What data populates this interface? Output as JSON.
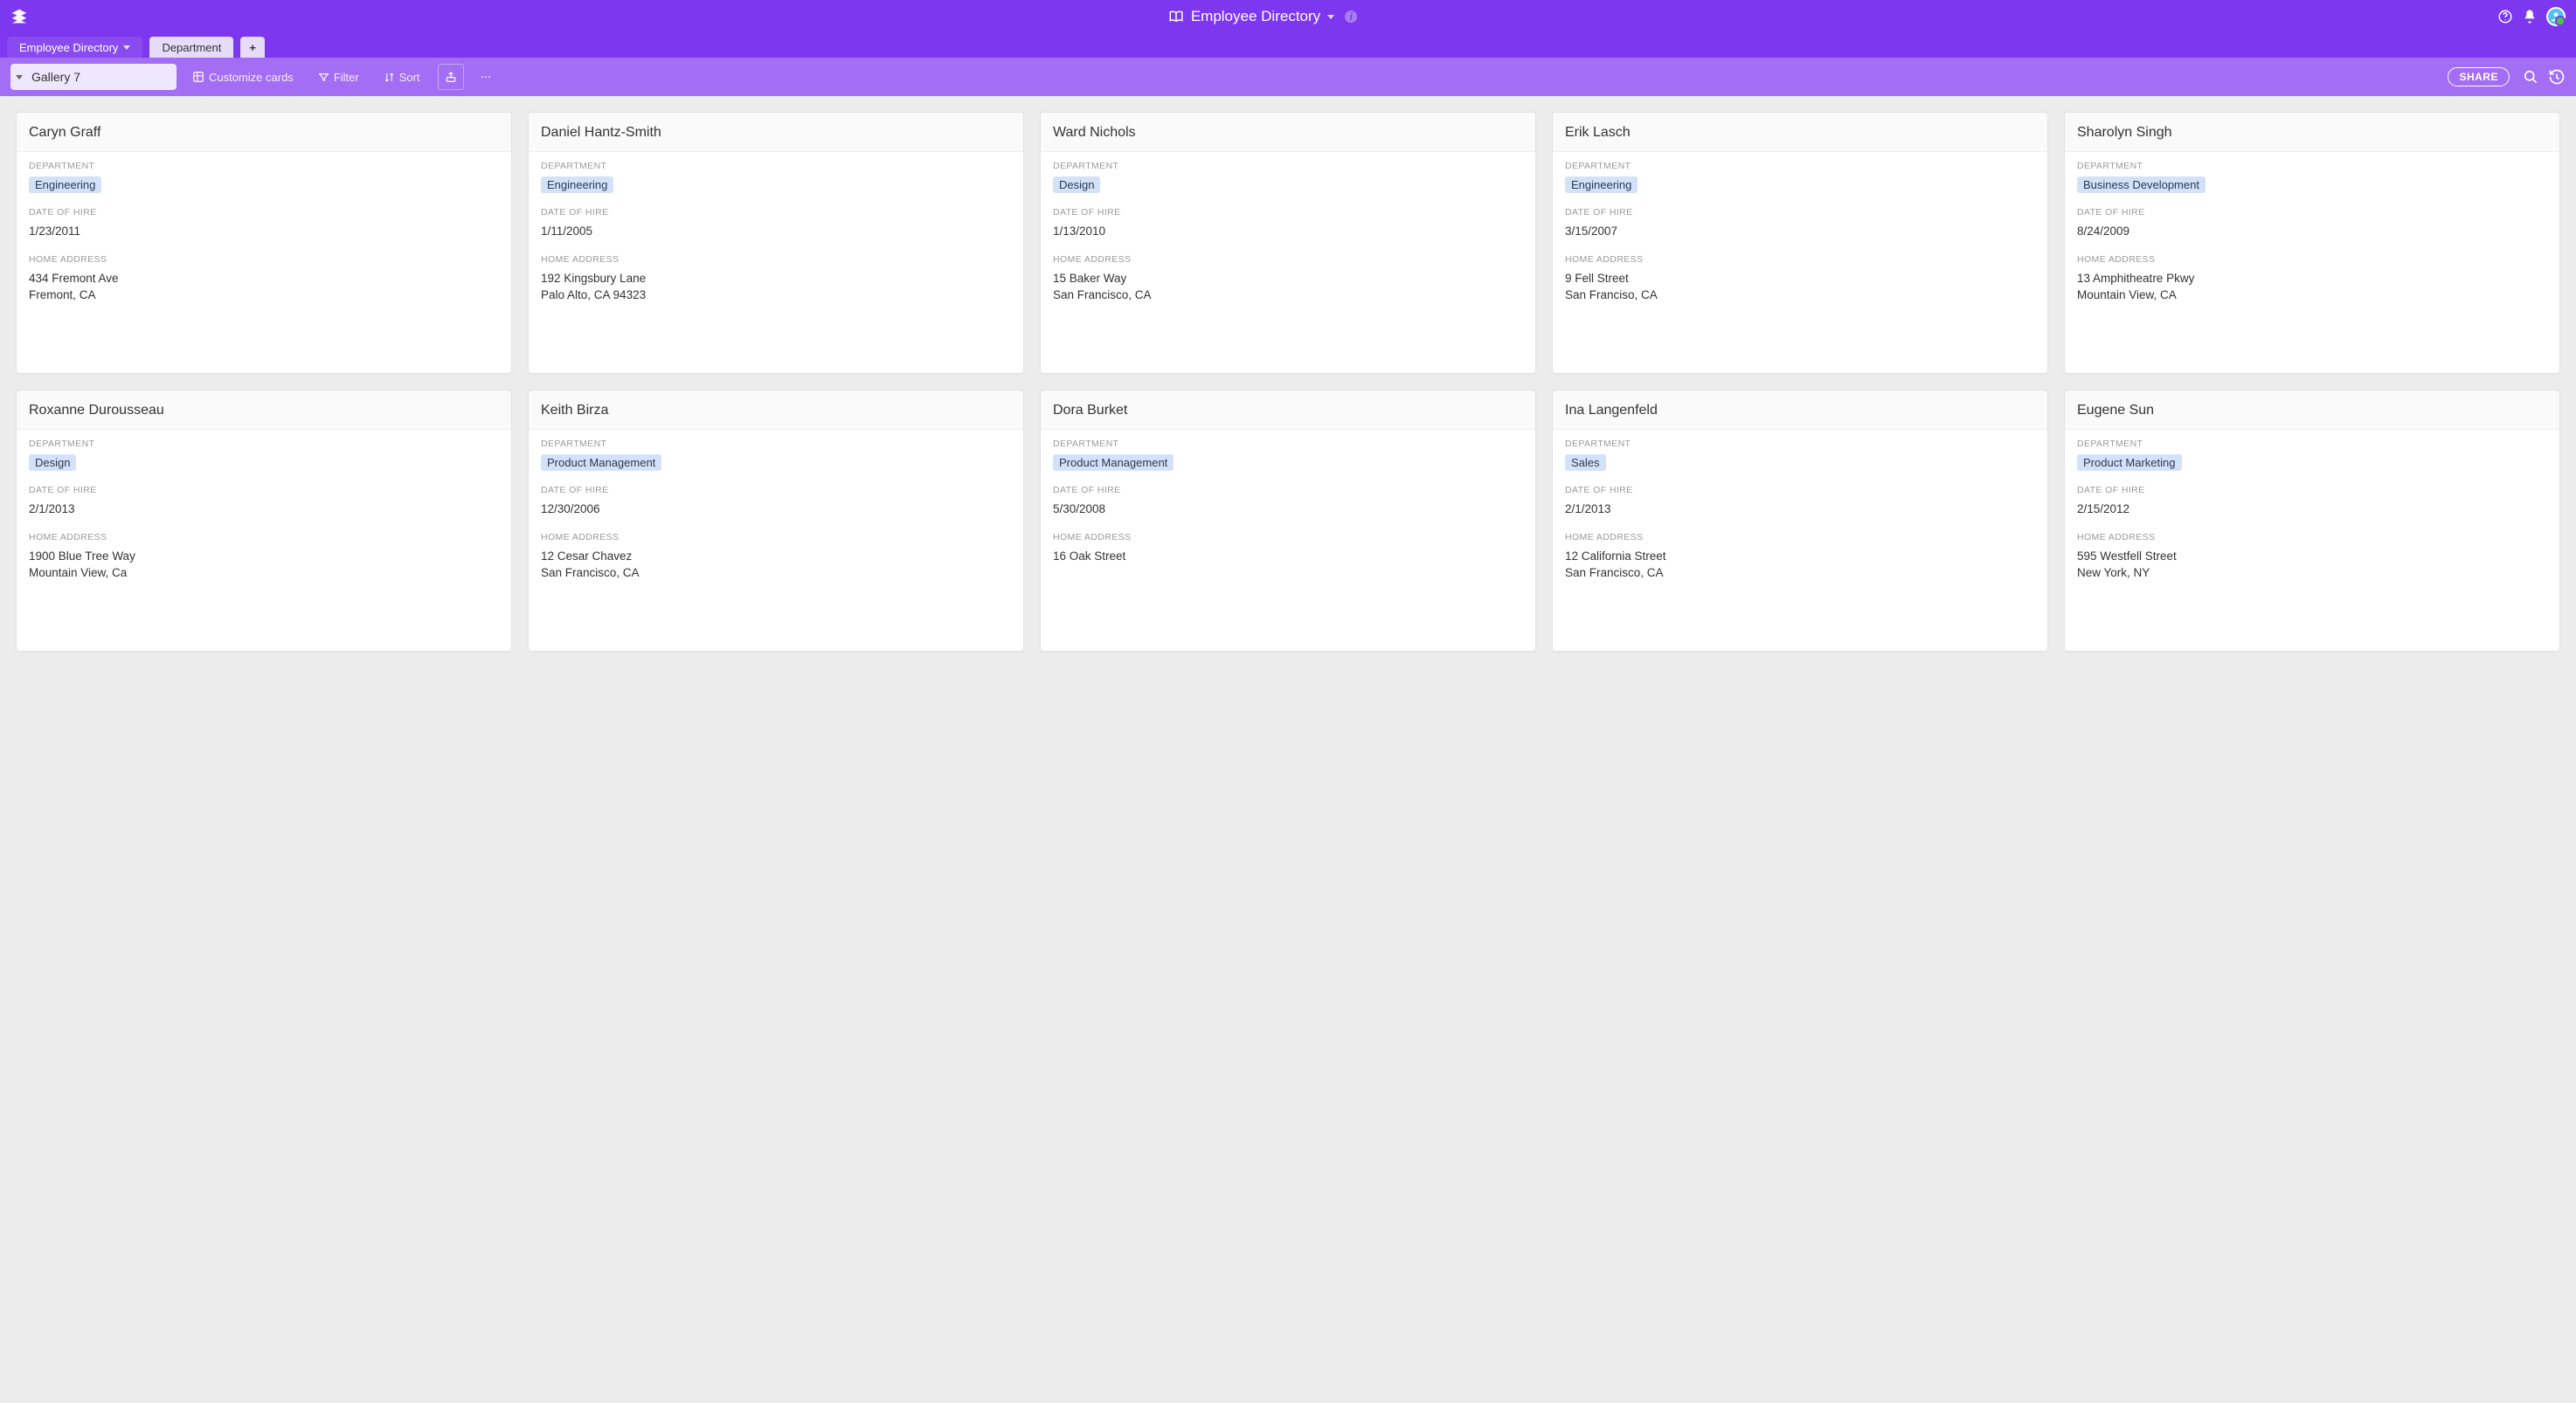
{
  "header": {
    "title": "Employee Directory"
  },
  "tabs": {
    "primary": "Employee Directory",
    "secondary": "Department",
    "add": "+"
  },
  "toolbar": {
    "view_name": "Gallery 7",
    "customize": "Customize cards",
    "filter": "Filter",
    "sort": "Sort",
    "share": "SHARE"
  },
  "labels": {
    "department": "DEPARTMENT",
    "date_of_hire": "DATE OF HIRE",
    "home_address": "HOME ADDRESS"
  },
  "cards": [
    {
      "name": "Caryn Graff",
      "department": "Engineering",
      "hire": "1/23/2011",
      "address": "434 Fremont Ave\nFremont, CA"
    },
    {
      "name": "Daniel Hantz-Smith",
      "department": "Engineering",
      "hire": "1/11/2005",
      "address": "192 Kingsbury Lane\nPalo Alto, CA 94323"
    },
    {
      "name": "Ward Nichols",
      "department": "Design",
      "hire": "1/13/2010",
      "address": "15 Baker Way\nSan Francisco, CA"
    },
    {
      "name": "Erik Lasch",
      "department": "Engineering",
      "hire": "3/15/2007",
      "address": "9 Fell Street\nSan Franciso, CA"
    },
    {
      "name": "Sharolyn Singh",
      "department": "Business Development",
      "hire": "8/24/2009",
      "address": "13 Amphitheatre Pkwy\nMountain View, CA"
    },
    {
      "name": "Roxanne Durousseau",
      "department": "Design",
      "hire": "2/1/2013",
      "address": "1900 Blue Tree Way\nMountain View, Ca"
    },
    {
      "name": "Keith Birza",
      "department": "Product Management",
      "hire": "12/30/2006",
      "address": "12 Cesar Chavez\nSan Francisco, CA"
    },
    {
      "name": "Dora Burket",
      "department": "Product Management",
      "hire": "5/30/2008",
      "address": "16 Oak Street"
    },
    {
      "name": "Ina Langenfeld",
      "department": "Sales",
      "hire": "2/1/2013",
      "address": "12 California Street\nSan Francisco, CA"
    },
    {
      "name": "Eugene Sun",
      "department": "Product Marketing",
      "hire": "2/15/2012",
      "address": "595 Westfell Street\nNew York, NY"
    }
  ]
}
